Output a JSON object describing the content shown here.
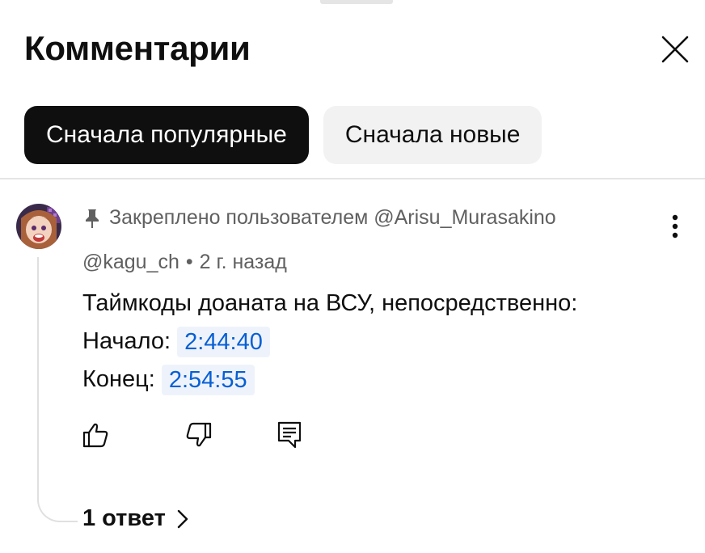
{
  "header": {
    "title": "Комментарии"
  },
  "sort_chips": [
    {
      "label": "Сначала популярные",
      "selected": true
    },
    {
      "label": "Сначала новые",
      "selected": false
    }
  ],
  "comment": {
    "pinned_text": "Закреплено пользователем @Arisu_Murasakino",
    "author": "@kagu_ch",
    "separator": "•",
    "time": "2 г. назад",
    "lines": {
      "intro": "Таймкоды доаната на ВСУ, непосредственно:",
      "start_label": "Начало:",
      "start_time": "2:44:40",
      "end_label": "Конец:",
      "end_time": "2:54:55"
    },
    "replies_label": "1 ответ"
  },
  "icons": {
    "close": "close-icon",
    "pin": "pin-icon",
    "more": "more-vert-icon",
    "like": "thumb-up-icon",
    "dislike": "thumb-down-icon",
    "reply": "reply-icon",
    "chevron": "chevron-right-icon"
  },
  "colors": {
    "chip_active_bg": "#0f0f0f",
    "chip_inactive_bg": "#f2f2f2",
    "timestamp_link": "#065fd4",
    "timestamp_bg": "#eef3fb",
    "secondary_text": "#606060"
  }
}
